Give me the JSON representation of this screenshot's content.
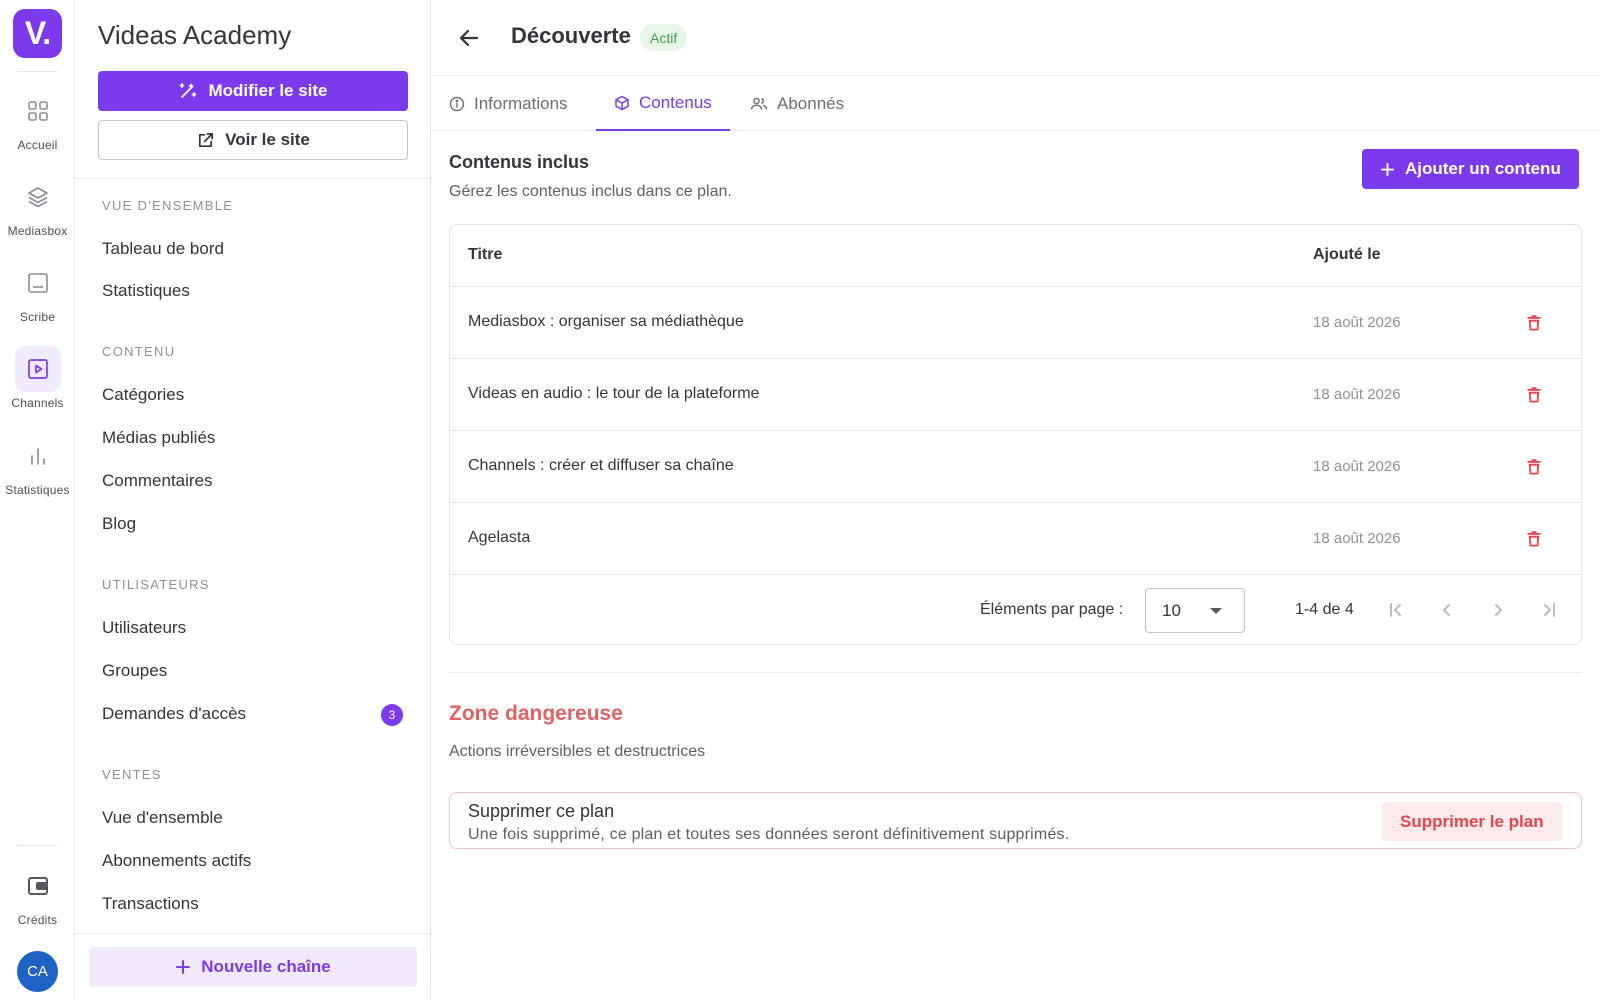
{
  "rail": {
    "logo": "V.",
    "items": [
      {
        "label": "Accueil",
        "icon": "grid-icon"
      },
      {
        "label": "Mediasbox",
        "icon": "layers-icon"
      },
      {
        "label": "Scribe",
        "icon": "subtitles-icon"
      },
      {
        "label": "Channels",
        "icon": "play-square-icon",
        "active": true
      },
      {
        "label": "Statistiques",
        "icon": "bar-chart-icon"
      }
    ],
    "credits_label": "Crédits",
    "avatar_initials": "CA"
  },
  "sidebar": {
    "site_title": "Videas Academy",
    "edit_site_label": "Modifier le site",
    "view_site_label": "Voir le site",
    "sections": [
      {
        "label": "VUE D'ENSEMBLE",
        "items": [
          "Tableau de bord",
          "Statistiques"
        ]
      },
      {
        "label": "CONTENU",
        "items": [
          "Catégories",
          "Médias publiés",
          "Commentaires",
          "Blog"
        ]
      },
      {
        "label": "UTILISATEURS",
        "items": [
          "Utilisateurs",
          "Groupes",
          "Demandes d'accès"
        ]
      },
      {
        "label": "VENTES",
        "items": [
          "Vue d'ensemble",
          "Abonnements actifs",
          "Transactions"
        ]
      }
    ],
    "access_requests_badge": "3",
    "new_channel_label": "Nouvelle chaîne"
  },
  "header": {
    "title": "Découverte",
    "status": "Actif"
  },
  "tabs": [
    {
      "label": "Informations",
      "icon": "info-icon"
    },
    {
      "label": "Contenus",
      "icon": "cube-icon",
      "active": true
    },
    {
      "label": "Abonnés",
      "icon": "users-icon"
    }
  ],
  "contents": {
    "title": "Contenus inclus",
    "subtitle": "Gérez les contenus inclus dans ce plan.",
    "add_label": "Ajouter un contenu",
    "columns": {
      "title": "Titre",
      "added": "Ajouté le"
    },
    "rows": [
      {
        "title": "Mediasbox : organiser sa médiathèque",
        "date": "18 août 2026"
      },
      {
        "title": "Videas en audio : le tour de la plateforme",
        "date": "18 août 2026"
      },
      {
        "title": "Channels : créer et diffuser sa chaîne",
        "date": "18 août 2026"
      },
      {
        "title": "Agelasta",
        "date": "18 août 2026"
      }
    ],
    "pager": {
      "per_page_label": "Éléments par page :",
      "per_page_value": "10",
      "range": "1-4 de 4"
    }
  },
  "danger": {
    "title": "Zone dangereuse",
    "subtitle": "Actions irréversibles et destructrices",
    "box_title": "Supprimer ce plan",
    "box_desc": "Une fois supprimé, ce plan et toutes ses données seront définitivement supprimés.",
    "button_label": "Supprimer le plan"
  },
  "colors": {
    "accent": "#7c3aed",
    "accent_light": "#f1eaff",
    "success": "#3f9f50",
    "danger": "#e4464b"
  }
}
